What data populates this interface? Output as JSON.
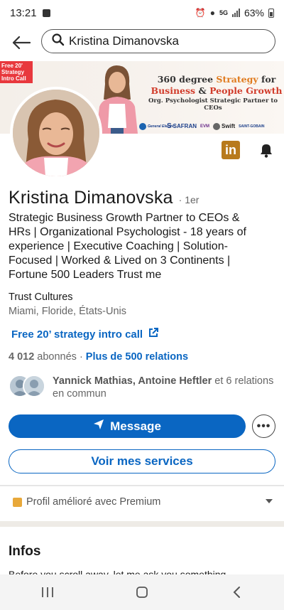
{
  "status_bar": {
    "time": "13:21",
    "network": "5G",
    "battery": "63%"
  },
  "search": {
    "query": "Kristina Dimanovska"
  },
  "banner": {
    "tag": "Free 20' Strategy Intro Call",
    "headline_a": "360 degree ",
    "headline_b": "Strategy",
    "headline_c": " for",
    "headline_d": "Business",
    "headline_e": " & ",
    "headline_f": "People Growth",
    "subline": "Org. Psychologist Strategic Partner to CEOs",
    "logos": [
      "General Electric",
      "SAFRAN",
      "EVM",
      "Swift",
      "SAINT-GOBAIN"
    ]
  },
  "profile": {
    "name": "Kristina Dimanovska",
    "degree": "· 1er",
    "headline": "Strategic Business Growth Partner to CEOs & HRs | Organizational Psychologist - 18 years of experience | Executive Coaching | Solution-Focused | Worked & Lived on 3 Continents | Fortune 500 Leaders Trust me",
    "company": "Trust Cultures",
    "location": "Miami, Floride, États-Unis",
    "external_link": "Free 20’ strategy intro call",
    "followers": "4 012",
    "followers_label": "abonnés",
    "separator": "·",
    "connections": "Plus de 500 relations",
    "mutual_names": "Yannick Mathias, Antoine Heftler",
    "mutual_rest": " et 6 relations en commun"
  },
  "actions": {
    "message_label": "Message",
    "more_label": "•••",
    "services_label": "Voir mes services"
  },
  "premium": {
    "label": "Profil amélioré avec Premium"
  },
  "sections": {
    "infos_title": "Infos",
    "infos_preview": "Before you scroll away, let me ask you something..."
  },
  "colors": {
    "brand_blue": "#0a66c2",
    "premium_gold": "#e8a83a",
    "banner_tag_red": "#e8383d"
  }
}
